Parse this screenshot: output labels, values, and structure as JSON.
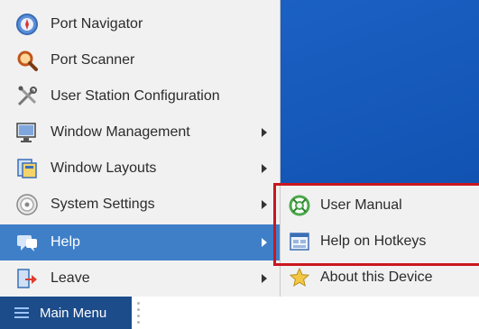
{
  "main_menu": {
    "items": [
      {
        "label": "Port Navigator",
        "icon": "compass-icon",
        "has_submenu": false
      },
      {
        "label": "Port Scanner",
        "icon": "magnifier-icon",
        "has_submenu": false
      },
      {
        "label": "User Station Configuration",
        "icon": "tools-icon",
        "has_submenu": false
      },
      {
        "label": "Window Management",
        "icon": "monitor-icon",
        "has_submenu": true
      },
      {
        "label": "Window Layouts",
        "icon": "layouts-icon",
        "has_submenu": true
      },
      {
        "label": "System Settings",
        "icon": "settings-dial-icon",
        "has_submenu": true
      },
      {
        "label": "Help",
        "icon": "help-speech-icon",
        "has_submenu": true,
        "active": true
      },
      {
        "label": "Leave",
        "icon": "leave-arrow-icon",
        "has_submenu": true
      }
    ]
  },
  "help_submenu": {
    "items": [
      {
        "label": "User Manual",
        "icon": "lifebuoy-icon"
      },
      {
        "label": "Help on Hotkeys",
        "icon": "keyboard-window-icon"
      },
      {
        "label": "About this Device",
        "icon": "star-icon"
      }
    ]
  },
  "taskbar": {
    "main_menu_label": "Main Menu"
  },
  "colors": {
    "desktop": "#1457b8",
    "active_item": "#3f7fc8",
    "annotation_box": "#c9171f",
    "taskbar": "#1c4c8a"
  }
}
